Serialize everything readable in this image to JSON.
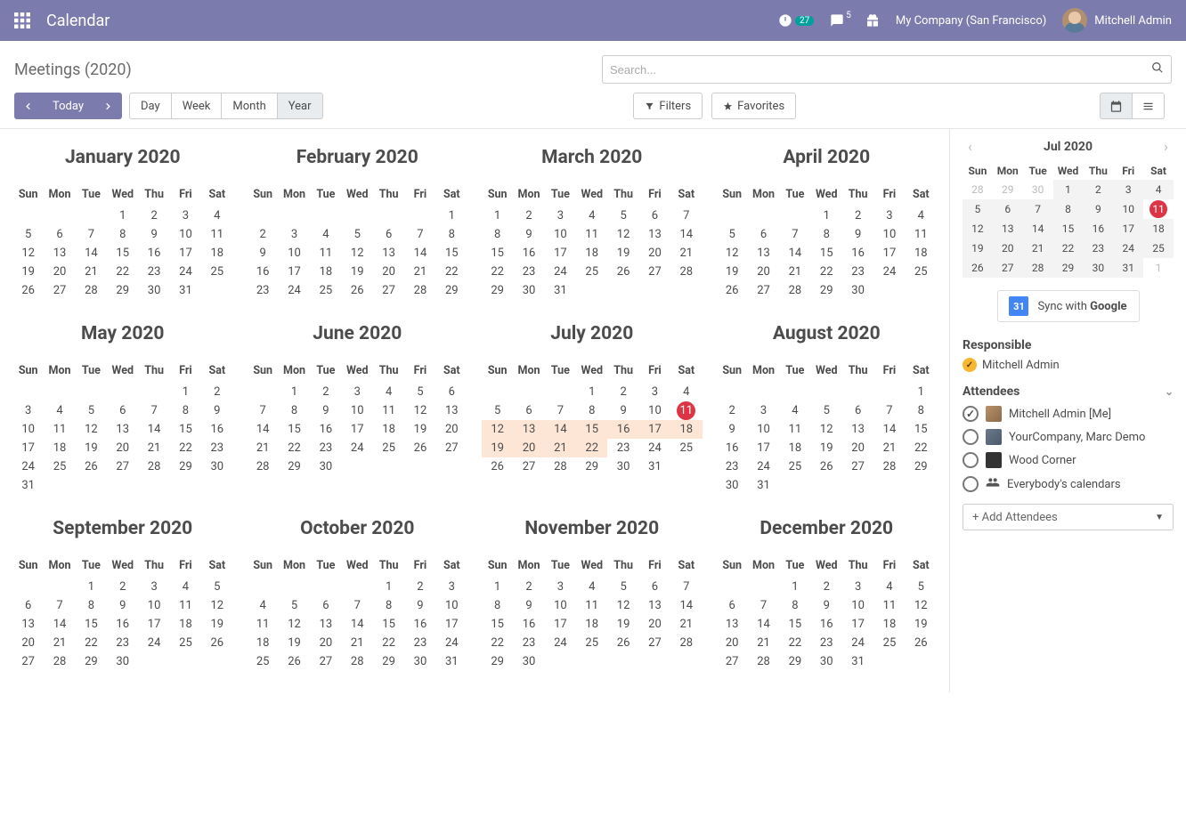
{
  "topbar": {
    "app_title": "Calendar",
    "clock_badge": "27",
    "chat_badge": "5",
    "company": "My Company (San Francisco)",
    "user": "Mitchell Admin"
  },
  "breadcrumb": "Meetings (2020)",
  "search": {
    "placeholder": "Search..."
  },
  "nav": {
    "today": "Today",
    "day": "Day",
    "week": "Week",
    "month": "Month",
    "year": "Year",
    "filters": "Filters",
    "favorites": "Favorites"
  },
  "year": 2020,
  "dow": [
    "Sun",
    "Mon",
    "Tue",
    "Wed",
    "Thu",
    "Fri",
    "Sat"
  ],
  "months": [
    {
      "title": "January 2020",
      "offset": 3,
      "days": 31
    },
    {
      "title": "February 2020",
      "offset": 6,
      "days": 29
    },
    {
      "title": "March 2020",
      "offset": 0,
      "days": 31
    },
    {
      "title": "April 2020",
      "offset": 3,
      "days": 30
    },
    {
      "title": "May 2020",
      "offset": 5,
      "days": 31
    },
    {
      "title": "June 2020",
      "offset": 1,
      "days": 30
    },
    {
      "title": "July 2020",
      "offset": 3,
      "days": 31,
      "today": 11,
      "highlight": [
        12,
        13,
        14,
        15,
        16,
        17,
        18,
        19,
        20,
        21,
        22
      ]
    },
    {
      "title": "August 2020",
      "offset": 6,
      "days": 31
    },
    {
      "title": "September 2020",
      "offset": 2,
      "days": 30
    },
    {
      "title": "October 2020",
      "offset": 4,
      "days": 31
    },
    {
      "title": "November 2020",
      "offset": 0,
      "days": 30
    },
    {
      "title": "December 2020",
      "offset": 2,
      "days": 31
    }
  ],
  "mini": {
    "title": "Jul 2020",
    "dow": [
      "Sun",
      "Mon",
      "Tue",
      "Wed",
      "Thu",
      "Fri",
      "Sat"
    ],
    "prev": [
      28,
      29,
      30
    ],
    "days": 31,
    "next": [
      1
    ],
    "today": 11,
    "shaded_from": 1
  },
  "sync": {
    "label": "Sync with Google",
    "icon_text": "31"
  },
  "responsible": {
    "label": "Responsible",
    "name": "Mitchell Admin"
  },
  "attendees": {
    "label": "Attendees",
    "rows": [
      {
        "name": "Mitchell Admin [Me]",
        "checked": true,
        "cls": "a1"
      },
      {
        "name": "YourCompany, Marc Demo",
        "checked": false,
        "cls": "a2"
      },
      {
        "name": "Wood Corner",
        "checked": false,
        "cls": "a3"
      }
    ],
    "everybody": "Everybody's calendars",
    "add": "+ Add Attendees"
  }
}
